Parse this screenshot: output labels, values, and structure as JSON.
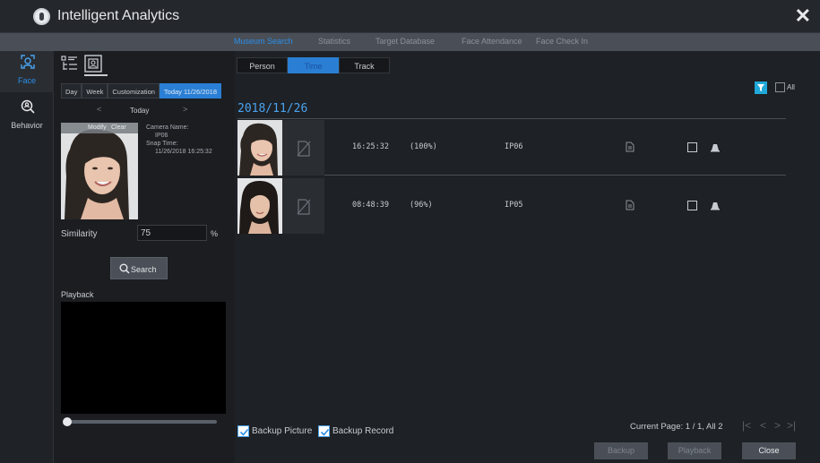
{
  "window": {
    "title": "Intelligent Analytics",
    "close_glyph": "✕"
  },
  "top_nav": [
    {
      "label": "Museum Search",
      "active": true
    },
    {
      "label": "Statistics",
      "active": false
    },
    {
      "label": "Target Database",
      "active": false
    },
    {
      "label": "Face Attendance",
      "active": false
    },
    {
      "label": "Face Check In",
      "active": false
    }
  ],
  "sidebar": [
    {
      "label": "Face",
      "icon": "face-icon",
      "active": true
    },
    {
      "label": "Behavior",
      "icon": "behavior-icon",
      "active": false
    }
  ],
  "left_panel": {
    "day_tabs": [
      {
        "label": "Day",
        "active": false
      },
      {
        "label": "Week",
        "active": false
      },
      {
        "label": "Customization",
        "active": false
      },
      {
        "label": "Today 11/26/2018",
        "active": true
      }
    ],
    "date_nav": {
      "prev": "<",
      "label": "Today",
      "next": ">"
    },
    "face_card": {
      "modify": "Modify",
      "clear": "Clear"
    },
    "camera_info": {
      "camera_name_label": "Camera Name:",
      "camera_name": "IP06",
      "snap_time_label": "Snap Time:",
      "snap_time": "11/26/2018 16:25:32"
    },
    "similarity": {
      "label": "Similarity",
      "value": "75",
      "unit": "%"
    },
    "search_button": "Search",
    "playback_label": "Playback",
    "playback_progress": 0
  },
  "main": {
    "tabs": [
      {
        "label": "Person",
        "active": false
      },
      {
        "label": "Time",
        "active": true
      },
      {
        "label": "Track",
        "active": false
      }
    ],
    "all_label": "All",
    "date_header": "2018/11/26",
    "results": [
      {
        "time": "16:25:32",
        "similarity": "(100%)",
        "camera": "IP06"
      },
      {
        "time": "08:48:39",
        "similarity": "(96%)",
        "camera": "IP05"
      }
    ],
    "footer": {
      "backup_picture": "Backup Picture",
      "backup_record": "Backup Record",
      "page_info": "Current Page: 1 / 1, All 2",
      "pager": [
        "|<",
        "<",
        ">",
        ">|"
      ],
      "buttons": {
        "backup": "Backup",
        "playback": "Playback",
        "close": "Close"
      }
    }
  },
  "colors": {
    "accent": "#2a8ee8",
    "active_tab": "#2a7fd4",
    "filter": "#20a8d8"
  }
}
